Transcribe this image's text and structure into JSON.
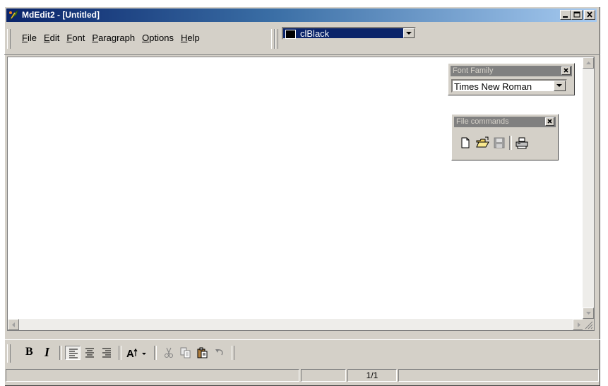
{
  "window": {
    "title": "MdEdit2 - [Untitled]",
    "icon": "app-feather-icon",
    "caption_buttons": [
      "minimize",
      "maximize",
      "close"
    ]
  },
  "menu": {
    "items": [
      {
        "label": "File",
        "accel": "F"
      },
      {
        "label": "Edit",
        "accel": "E"
      },
      {
        "label": "Font",
        "accel": "F"
      },
      {
        "label": "Paragraph",
        "accel": "P"
      },
      {
        "label": "Options",
        "accel": "O"
      },
      {
        "label": "Help",
        "accel": "H"
      }
    ]
  },
  "color_combo": {
    "value": "clBlack",
    "swatch": "#000000"
  },
  "font_family_palette": {
    "title": "Font Family",
    "value": "Times New Roman"
  },
  "file_commands_palette": {
    "title": "File commands",
    "buttons": [
      "new-document-icon",
      "open-folder-icon",
      "save-disk-icon",
      "print-icon"
    ]
  },
  "format_toolbar": {
    "bold_label": "B",
    "italic_label": "I",
    "buttons": [
      "bold",
      "italic",
      "align-left",
      "align-center",
      "align-right",
      "font-size",
      "cut",
      "copy",
      "paste",
      "undo"
    ],
    "active": "align-left"
  },
  "status": {
    "page": "1/1"
  },
  "colors": {
    "face": "#d4d0c8",
    "title_active_start": "#0a246a",
    "title_active_end": "#a6caf0",
    "palette_title": "#808080"
  }
}
